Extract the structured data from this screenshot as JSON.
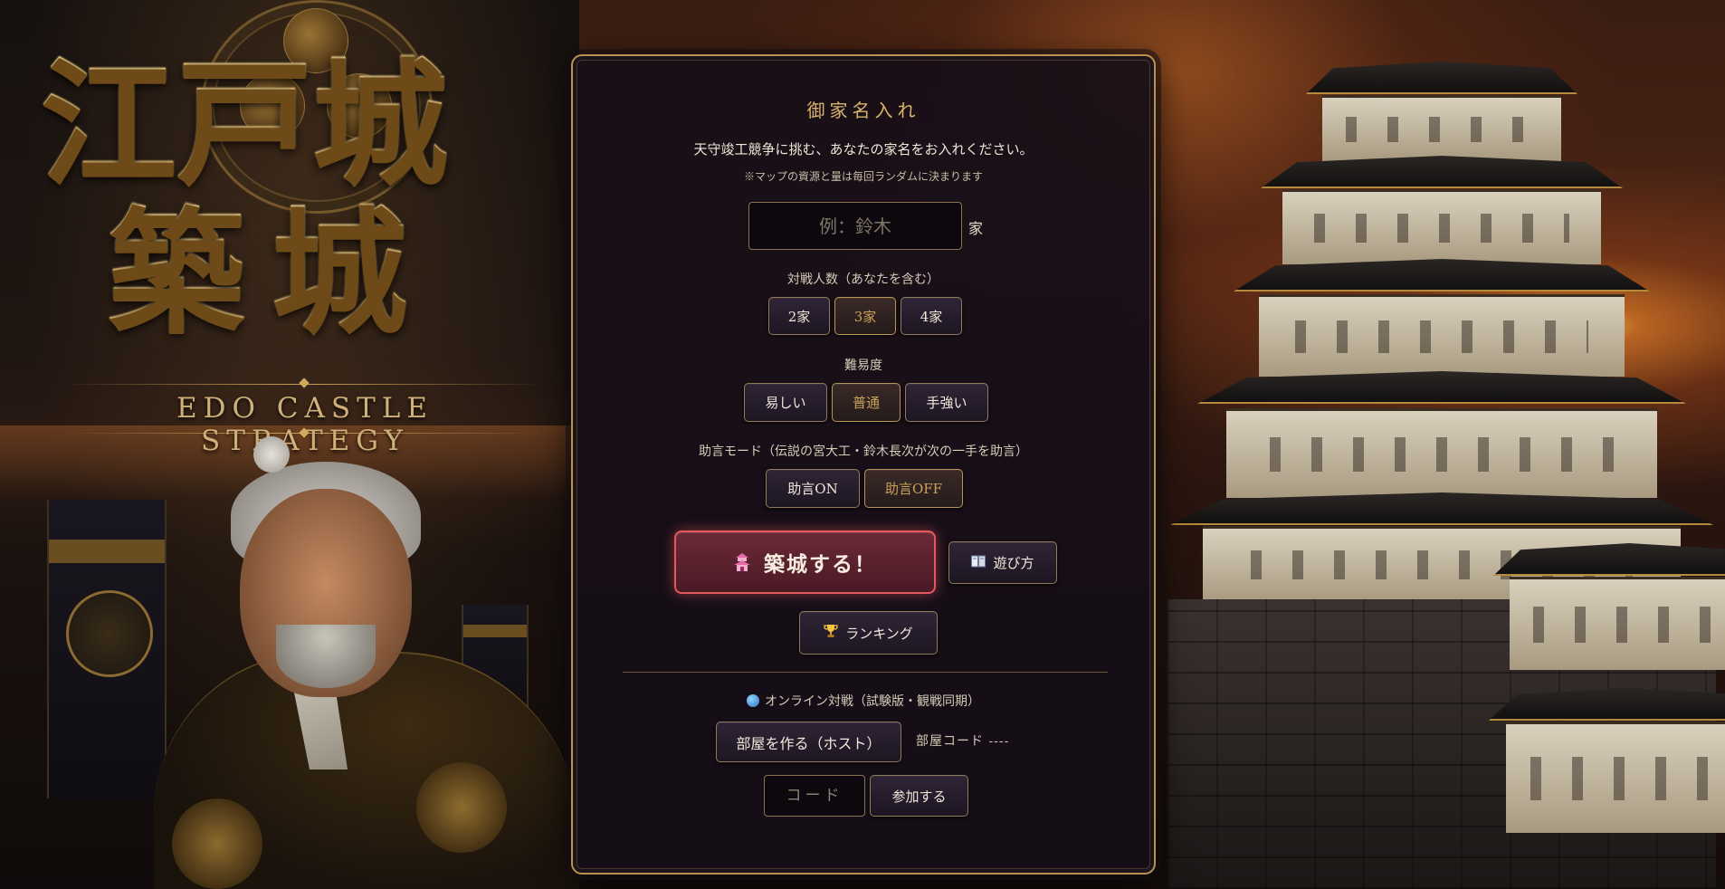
{
  "left_title": {
    "kanji_line1": "江戸城",
    "kanji_line2": "築城",
    "english": "EDO CASTLE STRATEGY"
  },
  "panel": {
    "heading": "御家名入れ",
    "lead": "天守竣工競争に挑む、あなたの家名をお入れください。",
    "note": "※マップの資源と量は毎回ランダムに決まります",
    "name_placeholder": "例：鈴木",
    "name_value": "",
    "name_suffix": "家",
    "players": {
      "label": "対戦人数（あなたを含む）",
      "options": [
        "2家",
        "3家",
        "4家"
      ],
      "selected": "3家"
    },
    "difficulty": {
      "label": "難易度",
      "options": [
        "易しい",
        "普通",
        "手強い"
      ],
      "selected": "普通"
    },
    "advice": {
      "label": "助言モード（伝説の宮大工・鈴木長次が次の一手を助言）",
      "options": [
        "助言ON",
        "助言OFF"
      ],
      "selected": "助言OFF"
    },
    "start_button": "築城する！",
    "start_icon": "pagoda-icon",
    "howto_button": "遊び方",
    "howto_icon": "book-icon",
    "ranking_button": "ランキング",
    "ranking_icon": "trophy-icon",
    "online": {
      "label": "オンライン対戦（試験版・観戦同期）",
      "label_icon": "globe-icon",
      "host_button": "部屋を作る（ホスト）",
      "room_code_text": "部屋コード ----",
      "code_placeholder": "コード",
      "join_button": "参加する"
    }
  },
  "colors": {
    "accent_gold": "#d8b36a",
    "start_red": "#e2585c",
    "panel_bg": "#160e18"
  }
}
